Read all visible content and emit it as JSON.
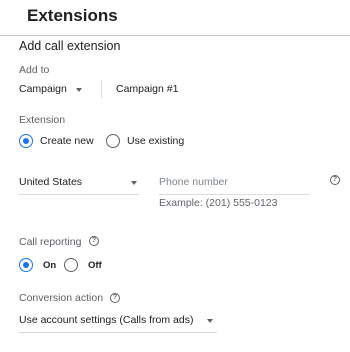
{
  "header": {
    "title": "Extensions"
  },
  "form": {
    "title": "Add call extension",
    "add_to": {
      "label": "Add to",
      "level_value": "Campaign",
      "target_value": "Campaign #1"
    },
    "extension": {
      "label": "Extension",
      "options": [
        "Create new",
        "Use existing"
      ],
      "selected": "Create new"
    },
    "country": {
      "value": "United States"
    },
    "phone": {
      "placeholder": "Phone number",
      "example": "Example: (201) 555-0123"
    },
    "call_reporting": {
      "label": "Call reporting",
      "options": [
        "On",
        "Off"
      ],
      "selected": "On"
    },
    "conversion_action": {
      "label": "Conversion action",
      "value": "Use account settings (Calls from ads)"
    }
  },
  "icons": {
    "help": "help-circle-icon",
    "dropdown": "caret-down-icon",
    "radio_selected": "radio-checked-icon",
    "radio_unselected": "radio-unchecked-icon"
  },
  "colors": {
    "accent": "#1a73e8",
    "text_primary": "#202124",
    "text_secondary": "#5f6368",
    "divider": "#dadce0"
  }
}
